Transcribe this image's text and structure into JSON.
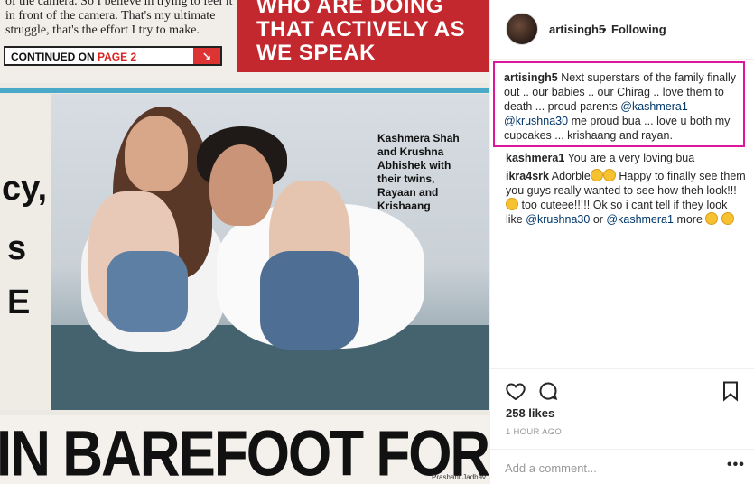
{
  "photo": {
    "top_text": [
      "of the camera. So I believe in trying to feel it",
      "in front of the camera. That's my ultimate",
      "struggle, that's the effort I try to make."
    ],
    "continued": {
      "label": "CONTINUED ON",
      "page": "PAGE 2"
    },
    "red_band_lines": [
      "WHO ARE DOING",
      "THAT ACTIVELY AS",
      "WE SPEAK"
    ],
    "left_fragment": [
      "cy,",
      "s",
      "E"
    ],
    "caption_lines": [
      "Kashmera Shah",
      "and Krushna",
      "Abhishek with",
      "their twins,",
      "Rayaan and",
      "Krishaang"
    ],
    "headline": "IN BAREFOOT FOR A DAY",
    "credit": "Prashant Jadhav"
  },
  "post": {
    "username": "artisingh5",
    "follow_separator": "•",
    "follow_status": "Following",
    "caption": {
      "user": "artisingh5",
      "text_a": "Next superstars of the family finally out .. our babies .. our Chirag .. love them to death ... proud parents",
      "mention_a": "@kashmera1",
      "mention_b": "@krushna30",
      "text_b": "me proud bua ... love u both my cupcakes ... krishaang and rayan."
    },
    "comments": [
      {
        "user": "kashmera1",
        "text": "You are a very loving bua"
      },
      {
        "user": "ikra4srk",
        "text_a": "Adorble",
        "text_b": "Happy to finally see them you guys really wanted to see how theh look!!!",
        "text_c": "too cuteee!!!!! Ok so i cant tell if they look like",
        "mention_a": "@krushna30",
        "or": "or",
        "mention_b": "@kashmera1",
        "text_d": "more"
      }
    ],
    "likes": "258 likes",
    "time_ago": "1 HOUR AGO",
    "add_comment_placeholder": "Add a comment...",
    "more_icon": "•••"
  },
  "icons": [
    "heart-icon",
    "comment-icon",
    "bookmark-icon",
    "more-options-icon"
  ]
}
